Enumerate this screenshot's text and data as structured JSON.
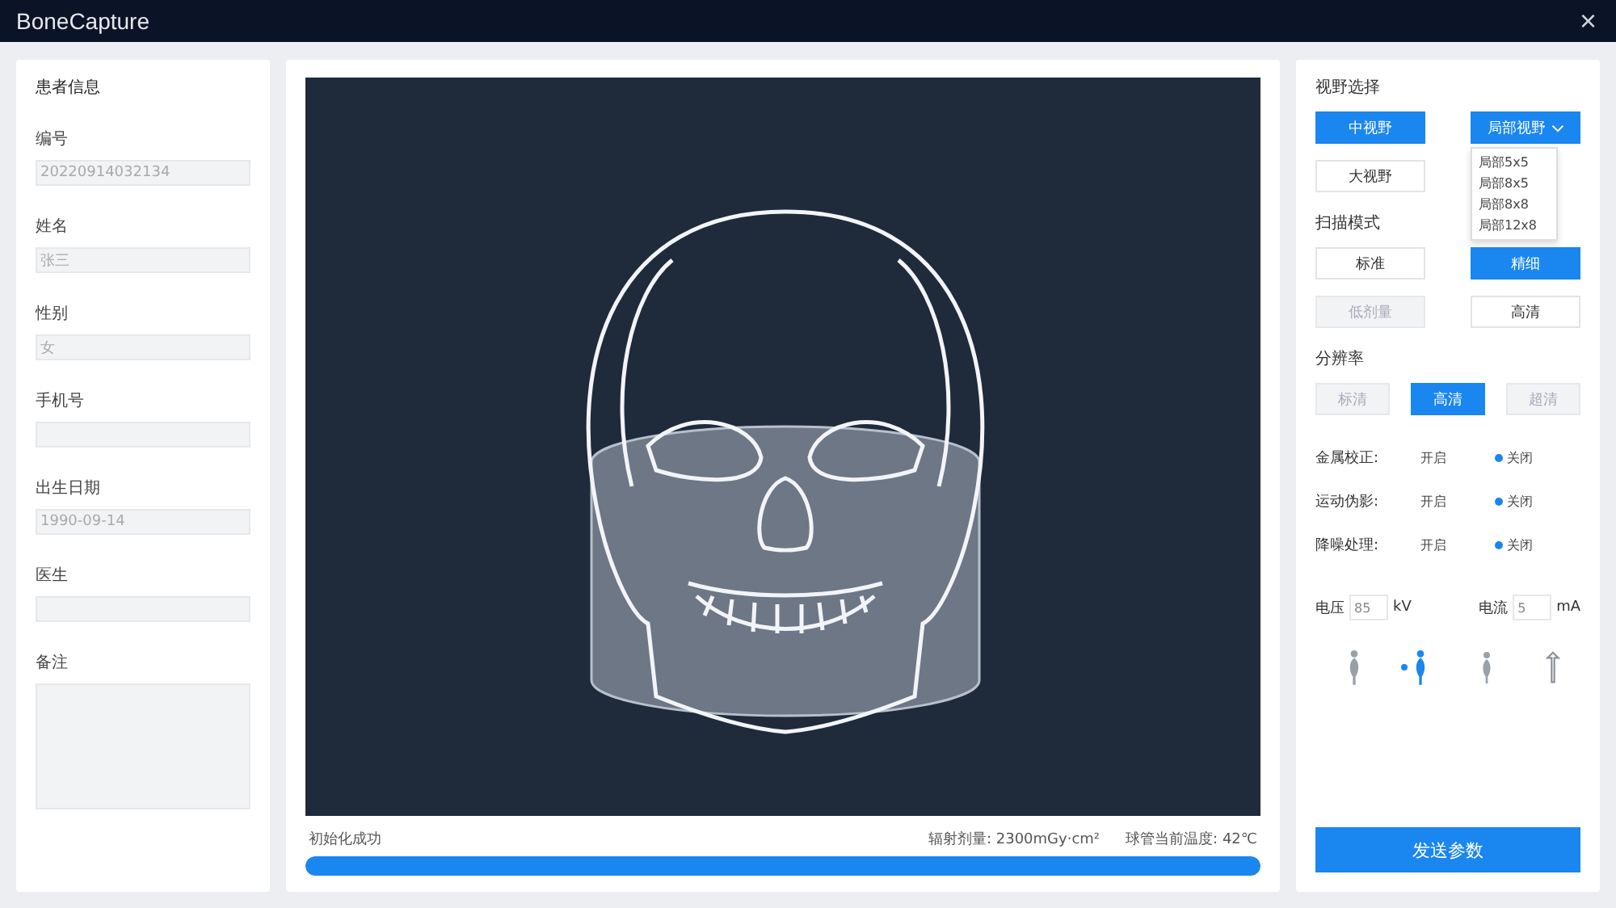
{
  "window": {
    "title": "BoneCapture",
    "close": "×"
  },
  "patient": {
    "title": "患者信息",
    "fields": [
      {
        "label": "编号",
        "value": "20220914032134",
        "kind": "input"
      },
      {
        "label": "姓名",
        "value": "张三",
        "kind": "input"
      },
      {
        "label": "性别",
        "value": "女",
        "kind": "input"
      },
      {
        "label": "手机号",
        "kind": "input"
      },
      {
        "label": "出生日期",
        "value": "1990-09-14",
        "kind": "input"
      },
      {
        "label": "医生",
        "kind": "input"
      },
      {
        "label": "备注",
        "kind": "textarea"
      }
    ]
  },
  "viewer": {
    "status": "初始化成功",
    "dose": "辐射剂量: 2300mGy·cm²",
    "temperature": "球管当前温度: 42℃",
    "progress": {
      "level": 1
    }
  },
  "settings": {
    "fov": {
      "title": "视野选择",
      "buttons": [
        {
          "label": "中视野",
          "selected": true,
          "disabled": false
        },
        {
          "label": "局部视野",
          "selected": true,
          "disabled": false,
          "kind": "dropdown"
        },
        {
          "label": "大视野",
          "selected": false,
          "disabled": false
        }
      ],
      "dropdown": {
        "open": true,
        "options": [
          "局部5x5",
          "局部8x5",
          "局部8x8",
          "局部12x8"
        ]
      }
    },
    "scan": {
      "title": "扫描模式",
      "buttons": [
        {
          "label": "标准",
          "selected": false,
          "disabled": false
        },
        {
          "label": "精细",
          "selected": true,
          "disabled": false
        },
        {
          "label": "低剂量",
          "selected": false,
          "disabled": true
        },
        {
          "label": "高清",
          "selected": false,
          "disabled": false
        }
      ]
    },
    "resolution": {
      "title": "分辨率",
      "buttons": [
        {
          "label": "标清",
          "selected": false,
          "disabled": true
        },
        {
          "label": "高清",
          "selected": true,
          "disabled": false
        },
        {
          "label": "超清",
          "selected": false,
          "disabled": true
        }
      ]
    },
    "toggles": [
      {
        "label": "金属校正:",
        "options": [
          {
            "label": "开启",
            "selected": false
          },
          {
            "label": "关闭",
            "selected": true
          }
        ]
      },
      {
        "label": "运动伪影:",
        "options": [
          {
            "label": "开启",
            "selected": false
          },
          {
            "label": "关闭",
            "selected": true
          }
        ]
      },
      {
        "label": "降噪处理:",
        "options": [
          {
            "label": "开启",
            "selected": false
          },
          {
            "label": "关闭",
            "selected": true
          }
        ]
      }
    ],
    "spinners": [
      {
        "label": "电压",
        "value": "85",
        "unit": "kV"
      },
      {
        "label": "电流",
        "value": "5",
        "unit": "mA"
      }
    ],
    "poses": [
      {
        "kind": "adult",
        "selected": false
      },
      {
        "kind": "adult",
        "selected": true
      },
      {
        "kind": "child",
        "selected": false
      },
      {
        "kind": "tool",
        "selected": false
      }
    ],
    "submit": "发送参数"
  }
}
